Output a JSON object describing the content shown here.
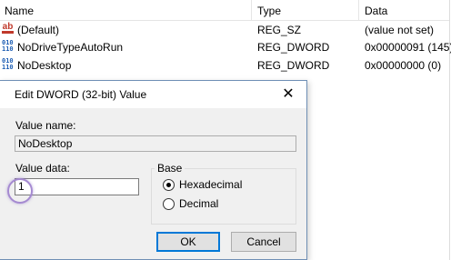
{
  "registry": {
    "columns": [
      "Name",
      "Type",
      "Data"
    ],
    "rows": [
      {
        "icon": "string-value-icon",
        "name": "(Default)",
        "type": "REG_SZ",
        "data": "(value not set)"
      },
      {
        "icon": "dword-value-icon",
        "name": "NoDriveTypeAutoRun",
        "type": "REG_DWORD",
        "data": "0x00000091 (145)"
      },
      {
        "icon": "dword-value-icon",
        "name": "NoDesktop",
        "type": "REG_DWORD",
        "data": "0x00000000 (0)"
      }
    ]
  },
  "dialog": {
    "title": "Edit DWORD (32-bit) Value",
    "close_glyph": "✕",
    "value_name_label": "Value name:",
    "value_name": "NoDesktop",
    "value_data_label": "Value data:",
    "value_data": "1",
    "base_label": "Base",
    "base_options": [
      "Hexadecimal",
      "Decimal"
    ],
    "base_selected": "Hexadecimal",
    "ok_label": "OK",
    "cancel_label": "Cancel"
  },
  "colors": {
    "accent": "#0078d7",
    "highlight_ring": "#a58ad1"
  }
}
